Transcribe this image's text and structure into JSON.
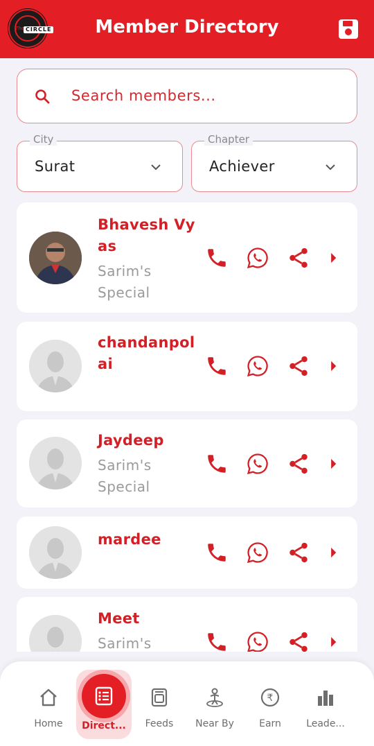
{
  "header": {
    "title": "Member Directory",
    "logo_text": "CIRCLE",
    "logo_small": "The"
  },
  "search": {
    "placeholder": "Search members..."
  },
  "filters": {
    "city": {
      "label": "City",
      "value": "Surat"
    },
    "chapter": {
      "label": "Chapter",
      "value": "Achiever"
    }
  },
  "members": [
    {
      "name": "Bhavesh Vyas",
      "subtitle": "Sarim's Special"
    },
    {
      "name": "chandanpolai",
      "subtitle": ""
    },
    {
      "name": "Jaydeep",
      "subtitle": "Sarim's Special"
    },
    {
      "name": "mardee",
      "subtitle": ""
    },
    {
      "name": "Meet",
      "subtitle": "Sarim's"
    }
  ],
  "bottom_nav": [
    {
      "label": "Home",
      "icon": "home-icon"
    },
    {
      "label": "Direct...",
      "icon": "directory-list-icon",
      "active": true
    },
    {
      "label": "Feeds",
      "icon": "feeds-icon"
    },
    {
      "label": "Near By",
      "icon": "nearby-person-icon"
    },
    {
      "label": "Earn",
      "icon": "rupee-icon"
    },
    {
      "label": "Leade...",
      "icon": "leaderboard-bar-icon"
    }
  ],
  "colors": {
    "primary": "#e31e25",
    "accent_text": "#d32027",
    "background": "#f3f2f8"
  }
}
